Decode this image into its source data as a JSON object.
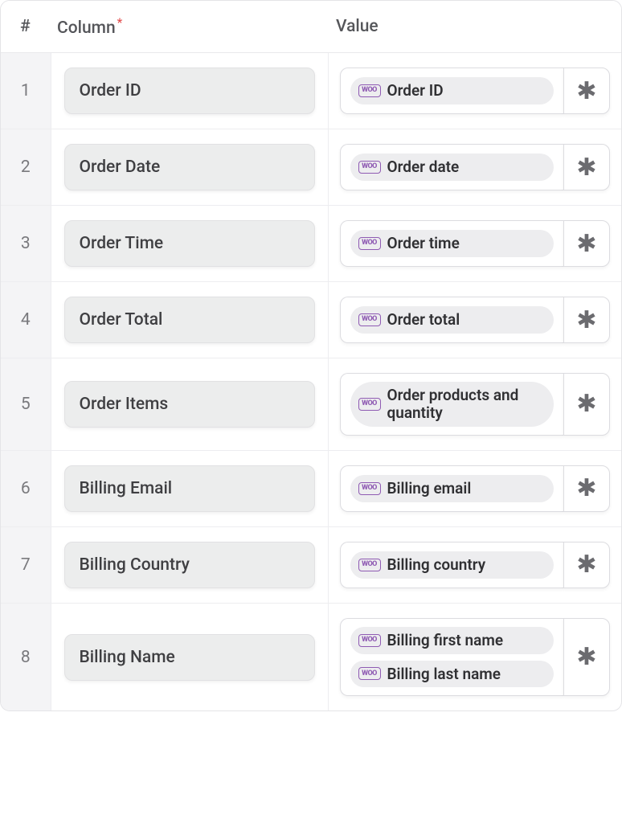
{
  "headers": {
    "num": "#",
    "column": "Column",
    "required_marker": "*",
    "value": "Value"
  },
  "woo_badge_text": "WOO",
  "action_glyph": "✱",
  "rows": [
    {
      "num": "1",
      "column": "Order ID",
      "values": [
        {
          "label": "Order ID"
        }
      ]
    },
    {
      "num": "2",
      "column": "Order Date",
      "values": [
        {
          "label": "Order date"
        }
      ]
    },
    {
      "num": "3",
      "column": "Order Time",
      "values": [
        {
          "label": "Order time"
        }
      ]
    },
    {
      "num": "4",
      "column": "Order Total",
      "values": [
        {
          "label": "Order total"
        }
      ]
    },
    {
      "num": "5",
      "column": "Order Items",
      "values": [
        {
          "label": "Order products and quantity"
        }
      ]
    },
    {
      "num": "6",
      "column": "Billing Email",
      "values": [
        {
          "label": "Billing email"
        }
      ]
    },
    {
      "num": "7",
      "column": "Billing Country",
      "values": [
        {
          "label": "Billing country"
        }
      ]
    },
    {
      "num": "8",
      "column": "Billing Name",
      "values": [
        {
          "label": "Billing first name"
        },
        {
          "label": "Billing last name"
        }
      ]
    }
  ]
}
